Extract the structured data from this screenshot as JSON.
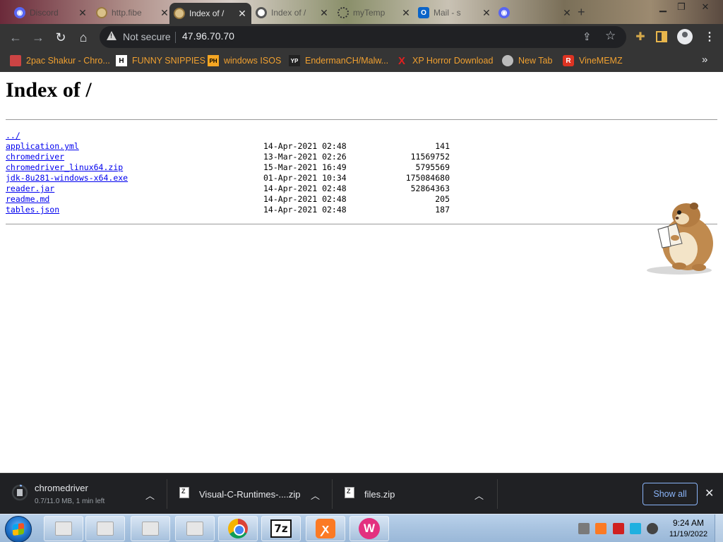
{
  "browser": {
    "tabs": [
      {
        "title": "Discord",
        "icon": "discord-icon"
      },
      {
        "title": "http.fibe",
        "icon": "globe-icon"
      },
      {
        "title": "Index of /",
        "icon": "globe-icon",
        "active": true
      },
      {
        "title": "Index of /",
        "icon": "chrome-icon"
      },
      {
        "title": "myTemp",
        "icon": "dots-icon"
      },
      {
        "title": "Mail - s",
        "icon": "outlook-icon"
      },
      {
        "title": "",
        "icon": "discord-icon"
      }
    ],
    "omnibox": {
      "security_label": "Not secure",
      "url": "47.96.70.70"
    },
    "bookmarks": [
      {
        "label": "2pac Shakur - Chro...",
        "icon": "folder-image-icon"
      },
      {
        "label": "FUNNY SNIPPIES",
        "icon": "h-icon"
      },
      {
        "label": "windows ISOS",
        "icon": "ph-icon"
      },
      {
        "label": "EndermanCH/Malw...",
        "icon": "yp-icon"
      },
      {
        "label": "XP Horror Download",
        "icon": "x-icon"
      },
      {
        "label": "New Tab",
        "icon": "globe-icon"
      },
      {
        "label": "VineMEMZ",
        "icon": "r-icon"
      }
    ]
  },
  "page": {
    "title": "Index of /",
    "entries": [
      {
        "name": "../",
        "date": "",
        "size": ""
      },
      {
        "name": "application.yml",
        "date": "14-Apr-2021 02:48",
        "size": "141"
      },
      {
        "name": "chromedriver",
        "date": "13-Mar-2021 02:26",
        "size": "11569752"
      },
      {
        "name": "chromedriver_linux64.zip",
        "date": "15-Mar-2021 16:49",
        "size": "5795569"
      },
      {
        "name": "jdk-8u281-windows-x64.exe",
        "date": "01-Apr-2021 10:34",
        "size": "175084680"
      },
      {
        "name": "reader.jar",
        "date": "14-Apr-2021 02:48",
        "size": "52864363"
      },
      {
        "name": "readme.md",
        "date": "14-Apr-2021 02:48",
        "size": "205"
      },
      {
        "name": "tables.json",
        "date": "14-Apr-2021 02:48",
        "size": "187"
      }
    ]
  },
  "downloads": {
    "items": [
      {
        "name": "chromedriver",
        "status": "0.7/11.0 MB, 1 min left"
      },
      {
        "name": "Visual-C-Runtimes-....zip",
        "status": ""
      },
      {
        "name": "files.zip",
        "status": ""
      }
    ],
    "show_all_label": "Show all"
  },
  "taskbar": {
    "apps": [
      "explorer",
      "explorer",
      "explorer",
      "explorer",
      "chrome",
      "7-zip",
      "xampp",
      "wampserver"
    ],
    "sevenzip_label": "7z",
    "xampp_label": "ꭗ",
    "wamp_label": "W",
    "clock_time": "9:24 AM",
    "clock_date": "11/19/2022"
  },
  "colors": {
    "chrome_dark": "#353535",
    "bookmark_text": "#f0a030",
    "link": "#0000ee",
    "download_accent": "#8ab4f8",
    "taskbar": "#a8c3e0"
  }
}
